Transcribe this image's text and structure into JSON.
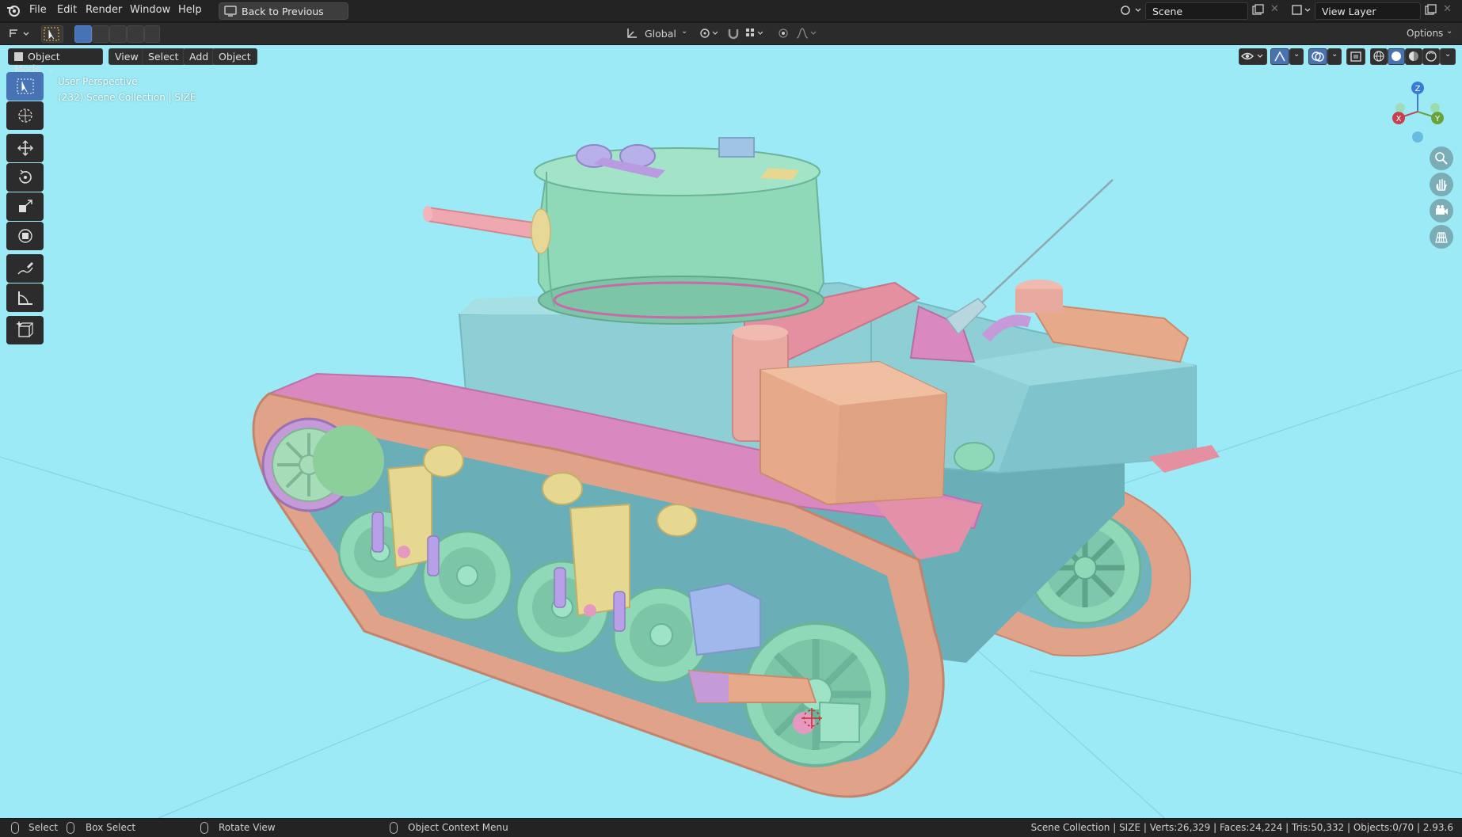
{
  "menubar": {
    "items": [
      "File",
      "Edit",
      "Render",
      "Window",
      "Help"
    ],
    "back_button": "Back to Previous",
    "scene_label": "Scene",
    "view_layer_label": "View Layer"
  },
  "toolrow": {
    "orientation": "Global",
    "options_label": "Options"
  },
  "viewport_header": {
    "mode": "Object Mode",
    "view": "View",
    "select": "Select",
    "add": "Add",
    "object": "Object"
  },
  "overlay": {
    "line1": "User Perspective",
    "line2": "(232) Scene Collection | SIZE"
  },
  "gizmo": {
    "z": "Z",
    "y": "Y",
    "x": "X"
  },
  "statusbar": {
    "select": "Select",
    "box_select": "Box Select",
    "rotate_view": "Rotate View",
    "context_menu": "Object Context Menu",
    "stats": "Scene Collection | SIZE | Verts:26,329 | Faces:24,224 | Tris:50,332 | Objects:0/70 | 2.93.6"
  },
  "colors": {
    "viewport_bg": "#9ceaf6",
    "accent": "#4772b3",
    "hull": "#8ecfd6",
    "track": "#e0a38a",
    "turret": "#8fd8b8",
    "fender": "#d989c0"
  }
}
